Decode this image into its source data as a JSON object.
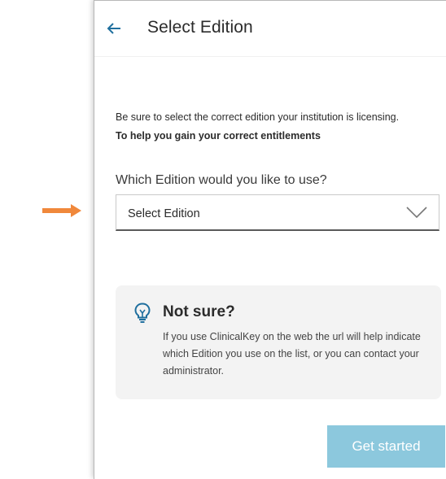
{
  "annotation": {
    "color": "#f0883b"
  },
  "header": {
    "back_icon": "arrow-left-icon",
    "title": "Select Edition",
    "accent_color": "#1f6f9e"
  },
  "intro": {
    "line1": "Be sure to select the correct edition your institution is licensing.",
    "line2": "To help you gain your correct entitlements"
  },
  "form": {
    "question": "Which Edition would you like to use?",
    "select": {
      "value": "Select Edition",
      "icon": "chevron-down-icon"
    }
  },
  "info_card": {
    "icon": "lightbulb-icon",
    "title": "Not sure?",
    "text": "If you use ClinicalKey on the web the url will help indicate which Edition you use on the list, or you can contact your administrator."
  },
  "cta": {
    "label": "Get started",
    "state": "disabled",
    "color": "#8cc8dd"
  }
}
